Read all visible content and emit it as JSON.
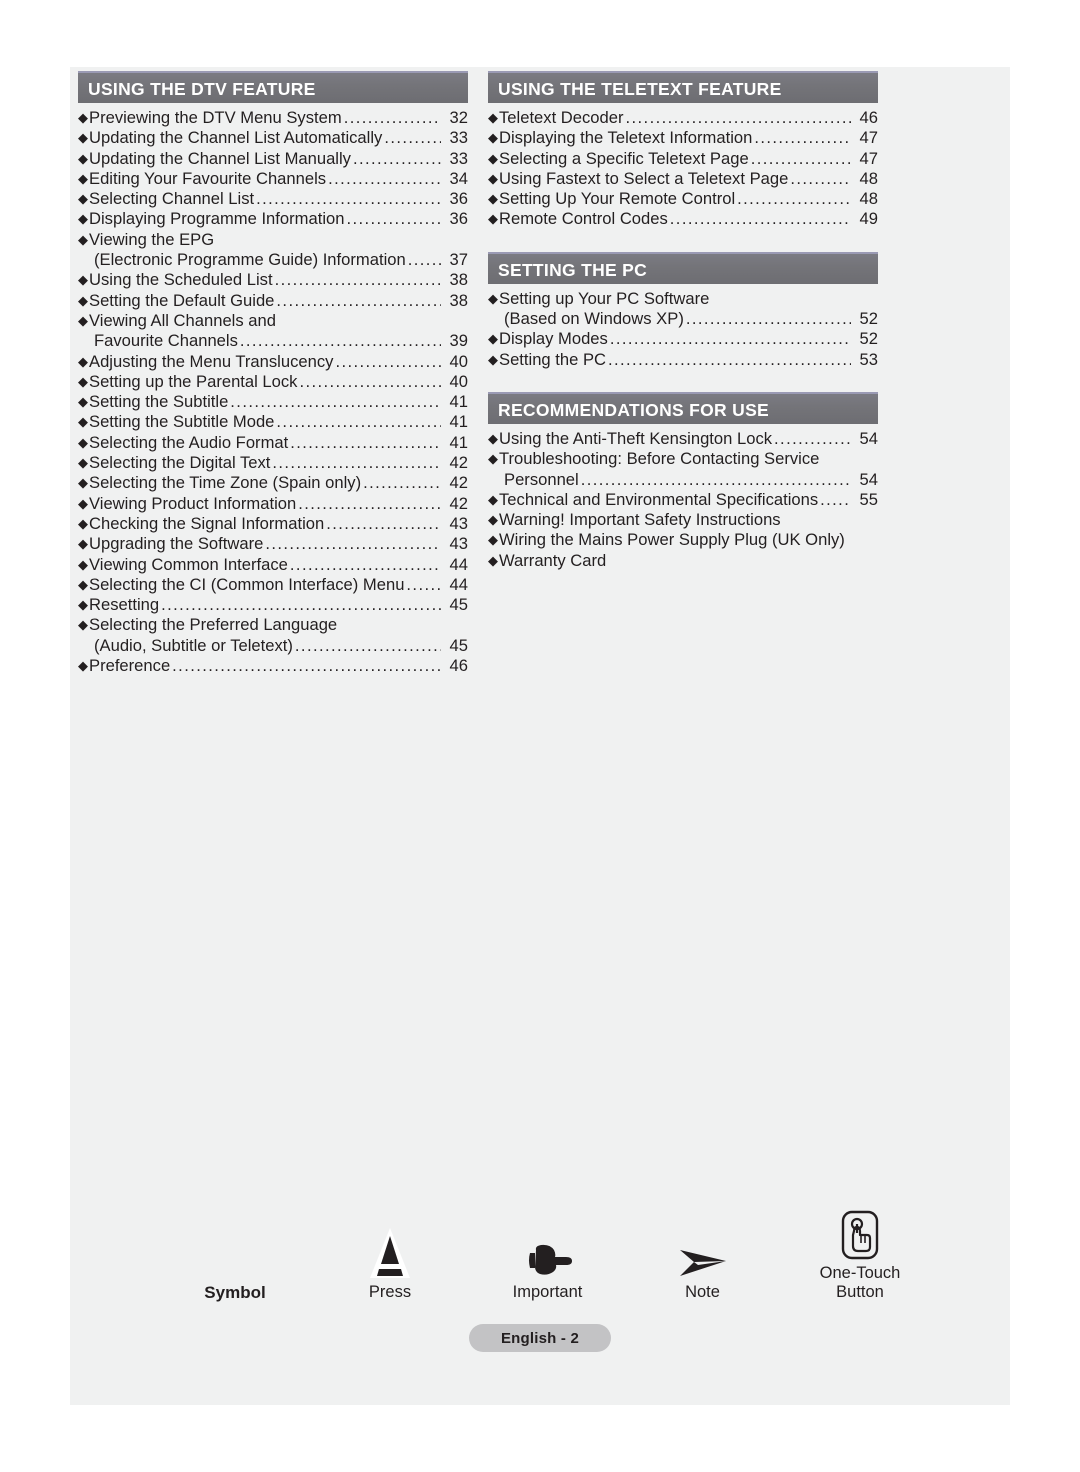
{
  "page": {
    "footer_badge": "English - 2"
  },
  "columns": [
    {
      "sections": [
        {
          "header": "USING THE DTV FEATURE",
          "entries": [
            {
              "title": "Previewing the DTV Menu System",
              "page": "32"
            },
            {
              "title": "Updating the Channel List Automatically",
              "page": "33"
            },
            {
              "title": "Updating the Channel List Manually",
              "page": "33"
            },
            {
              "title": "Editing Your Favourite Channels",
              "page": "34"
            },
            {
              "title": "Selecting Channel List",
              "page": "36"
            },
            {
              "title": "Displaying Programme Information",
              "page": "36"
            },
            {
              "title": "Viewing the EPG",
              "cont": "(Electronic Programme Guide) Information",
              "page": "37"
            },
            {
              "title": "Using the Scheduled List",
              "page": "38"
            },
            {
              "title": "Setting the Default Guide",
              "page": "38"
            },
            {
              "title": "Viewing All Channels and",
              "cont": "Favourite Channels",
              "page": "39"
            },
            {
              "title": "Adjusting the Menu Translucency",
              "page": "40"
            },
            {
              "title": "Setting up the Parental Lock",
              "page": "40"
            },
            {
              "title": "Setting the Subtitle",
              "page": "41"
            },
            {
              "title": "Setting the Subtitle Mode",
              "page": "41"
            },
            {
              "title": "Selecting the Audio Format",
              "page": "41"
            },
            {
              "title": "Selecting the Digital Text",
              "page": "42"
            },
            {
              "title": "Selecting the Time Zone (Spain only)",
              "page": "42"
            },
            {
              "title": "Viewing Product Information",
              "page": "42"
            },
            {
              "title": "Checking the Signal Information",
              "page": "43"
            },
            {
              "title": "Upgrading the Software",
              "page": "43"
            },
            {
              "title": "Viewing Common Interface",
              "page": "44"
            },
            {
              "title": "Selecting the CI (Common Interface) Menu",
              "page": "44"
            },
            {
              "title": "Resetting",
              "page": "45"
            },
            {
              "title": "Selecting the Preferred Language",
              "cont": "(Audio, Subtitle or Teletext)",
              "page": "45"
            },
            {
              "title": "Preference",
              "page": "46"
            }
          ]
        }
      ]
    },
    {
      "sections": [
        {
          "header": "USING THE TELETEXT FEATURE",
          "entries": [
            {
              "title": "Teletext Decoder",
              "page": "46"
            },
            {
              "title": "Displaying the Teletext Information",
              "page": "47"
            },
            {
              "title": "Selecting a Specific Teletext Page",
              "page": "47"
            },
            {
              "title": "Using Fastext to Select a Teletext Page",
              "page": "48"
            },
            {
              "title": "Setting Up Your Remote Control",
              "page": "48"
            },
            {
              "title": "Remote Control Codes",
              "page": "49"
            }
          ]
        },
        {
          "header": "SETTING THE PC",
          "entries": [
            {
              "title": "Setting up Your PC Software",
              "cont": "(Based on Windows XP)",
              "page": "52"
            },
            {
              "title": "Display Modes",
              "page": "52"
            },
            {
              "title": "Setting the PC",
              "page": "53"
            }
          ]
        },
        {
          "header": "RECOMMENDATIONS FOR USE",
          "entries": [
            {
              "title": "Using the Anti-Theft Kensington Lock",
              "page": "54"
            },
            {
              "title": "Troubleshooting: Before Contacting Service",
              "cont": "Personnel",
              "page": "54"
            },
            {
              "title": "Technical and Environmental Specifications",
              "page": "55"
            },
            {
              "title": "Warning! Important Safety Instructions",
              "page": ""
            },
            {
              "title": "Wiring the Mains Power Supply Plug (UK Only)",
              "page": ""
            },
            {
              "title": "Warranty Card",
              "page": ""
            }
          ]
        }
      ]
    }
  ],
  "legend": [
    {
      "icon": "none",
      "label": "Symbol",
      "label2": ""
    },
    {
      "icon": "press-triangle-icon",
      "label": "Press",
      "label2": ""
    },
    {
      "icon": "pointing-hand-icon",
      "label": "Important",
      "label2": ""
    },
    {
      "icon": "arrowhead-note-icon",
      "label": "Note",
      "label2": ""
    },
    {
      "icon": "one-touch-button-icon",
      "label": "One-Touch",
      "label2": "Button"
    }
  ],
  "colors": {
    "header_bar": "#74747a",
    "header_top_line": "#9a9ab4",
    "page_bg": "#f0f1f1",
    "text": "#231f20",
    "badge_bg": "#c3c3c5"
  }
}
